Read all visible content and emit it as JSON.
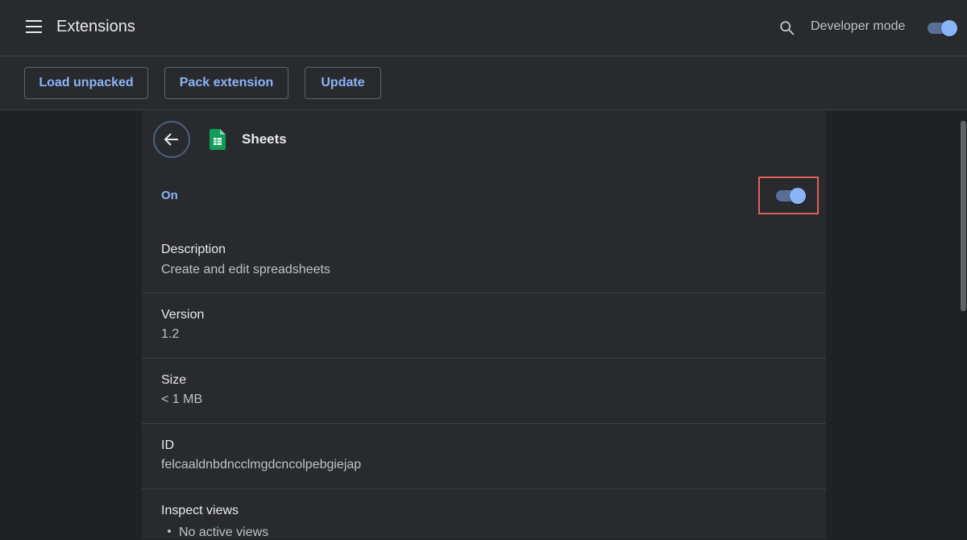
{
  "header": {
    "title": "Extensions",
    "search_icon": "search-icon",
    "developer_mode_label": "Developer mode",
    "developer_mode_on": true
  },
  "toolbar": {
    "load_unpacked": "Load unpacked",
    "pack_extension": "Pack extension",
    "update": "Update"
  },
  "extension": {
    "name": "Sheets",
    "icon": "sheets-icon",
    "status_label": "On",
    "enabled": true,
    "description_label": "Description",
    "description": "Create and edit spreadsheets",
    "version_label": "Version",
    "version": "1.2",
    "size_label": "Size",
    "size": "< 1 MB",
    "id_label": "ID",
    "id": "felcaaldnbdncclmgdcncolpebgiejap",
    "inspect_label": "Inspect views",
    "inspect_items": [
      "No active views"
    ]
  },
  "colors": {
    "accent": "#8ab4f8",
    "background": "#202124",
    "surface": "#292a2d",
    "highlight_frame": "#e0625b"
  }
}
